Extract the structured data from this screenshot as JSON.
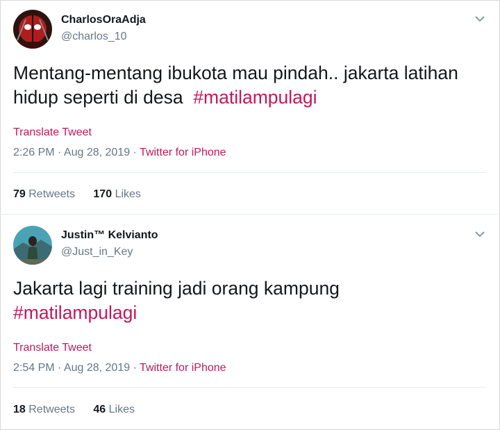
{
  "tweets": [
    {
      "name": "CharlosOraAdja",
      "handle": "@charlos_10",
      "text": "Mentang-mentang ibukota mau pindah.. jakarta latihan hidup seperti di desa",
      "hashtag": "#matilampulagi",
      "translate": "Translate Tweet",
      "time": "2:26 PM · Aug 28, 2019 · ",
      "source": "Twitter for iPhone",
      "retweets_count": "79",
      "retweets_label": "Retweets",
      "likes_count": "170",
      "likes_label": "Likes"
    },
    {
      "name": "Justin™ Kelvianto",
      "handle": "@Just_in_Key",
      "text": "Jakarta lagi training jadi orang kampung",
      "hashtag": "#matilampulagi",
      "translate": "Translate Tweet",
      "time": "2:54 PM · Aug 28, 2019 · ",
      "source": "Twitter for iPhone",
      "retweets_count": "18",
      "retweets_label": "Retweets",
      "likes_count": "46",
      "likes_label": "Likes"
    }
  ],
  "colors": {
    "accent": "#c2185b",
    "muted": "#657786",
    "text": "#14171a"
  },
  "icons": {
    "menu": "chevron-down-icon"
  }
}
